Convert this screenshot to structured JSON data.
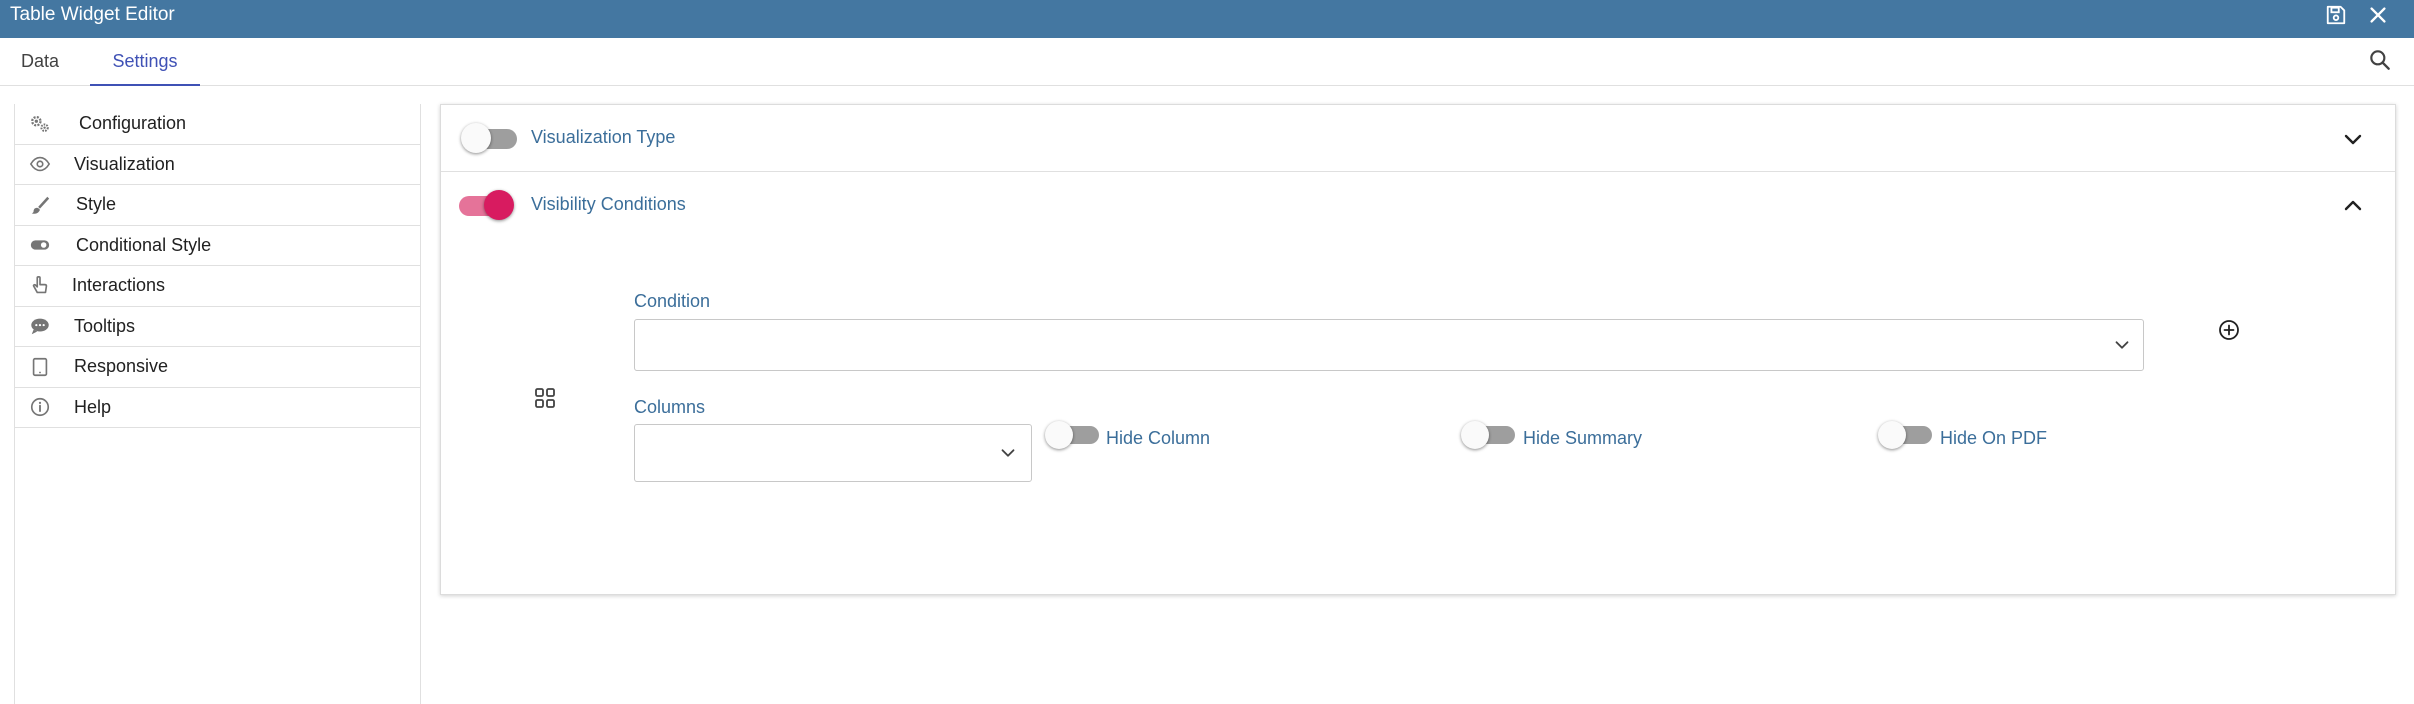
{
  "window": {
    "title": "Table Widget Editor",
    "save_icon": "save-icon",
    "close_icon": "close-icon"
  },
  "tabs": [
    {
      "label": "Data",
      "active": false
    },
    {
      "label": "Settings",
      "active": true
    }
  ],
  "header": {
    "search_icon": "search-icon"
  },
  "sidebar": {
    "items": [
      {
        "label": "Configuration",
        "icon": "gears-icon"
      },
      {
        "label": "Visualization",
        "icon": "eye-icon"
      },
      {
        "label": "Style",
        "icon": "brush-icon"
      },
      {
        "label": "Conditional Style",
        "icon": "toggle-icon"
      },
      {
        "label": "Interactions",
        "icon": "pointer-hand-icon"
      },
      {
        "label": "Tooltips",
        "icon": "comment-icon"
      },
      {
        "label": "Responsive",
        "icon": "tablet-icon"
      },
      {
        "label": "Help",
        "icon": "info-icon"
      }
    ]
  },
  "panels": {
    "visualization_type": {
      "title": "Visualization Type",
      "enabled": false,
      "expanded": false
    },
    "visibility_conditions": {
      "title": "Visibility Conditions",
      "enabled": true,
      "expanded": true,
      "condition_label": "Condition",
      "condition_value": "",
      "columns_label": "Columns",
      "columns_value": "",
      "hide_column_label": "Hide Column",
      "hide_column": false,
      "hide_summary_label": "Hide Summary",
      "hide_summary": false,
      "hide_on_pdf_label": "Hide On PDF",
      "hide_on_pdf": false,
      "add_icon": "add-circle-icon",
      "grid_icon": "grid-icon"
    }
  },
  "colors": {
    "titlebar": "#4477a1",
    "accent_tab": "#3f51b5",
    "label_blue": "#3b6e9a",
    "toggle_on": "#d81b60"
  }
}
